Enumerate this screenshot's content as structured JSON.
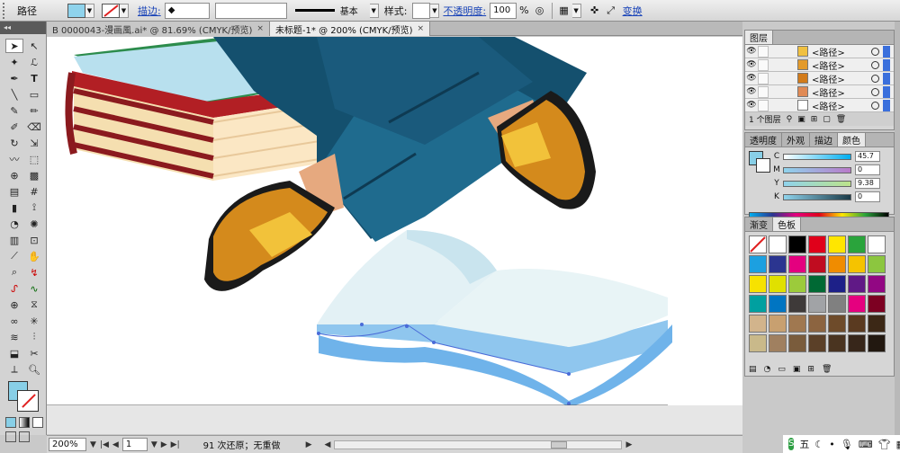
{
  "control_bar": {
    "object_type": "路径",
    "stroke_label": "描边:",
    "stroke_style": "基本",
    "style_label": "样式:",
    "opacity_label": "不透明度:",
    "opacity_value": "100",
    "opacity_unit": "%",
    "transform_link": "变换",
    "fill_color": "#8fd3ec"
  },
  "tabs": [
    {
      "label": "B 0000043-漫画風.ai* @ 81.69% (CMYK/预览)",
      "close": "×"
    },
    {
      "label": "未标题-1* @ 200% (CMYK/预览)",
      "close": "×"
    }
  ],
  "status": {
    "zoom": "200%",
    "page": "1",
    "message": "91 次还原；无重做"
  },
  "layers_panel": {
    "title": "图层",
    "rows": [
      {
        "name": "<路径>",
        "color": "#f0c040"
      },
      {
        "name": "<路径>",
        "color": "#e39a2a"
      },
      {
        "name": "<路径>",
        "color": "#d27b1a"
      },
      {
        "name": "<路径>",
        "color": "#e08a55"
      },
      {
        "name": "<路径>",
        "color": "#ffffff"
      }
    ],
    "footer": "1 个图层"
  },
  "color_panel": {
    "tabs": [
      "透明度",
      "外观",
      "描边",
      "颜色"
    ],
    "channels": [
      {
        "label": "C",
        "value": "45.7"
      },
      {
        "label": "M",
        "value": "0"
      },
      {
        "label": "Y",
        "value": "9.38"
      },
      {
        "label": "K",
        "value": "0"
      }
    ]
  },
  "swatches_panel": {
    "tabs": [
      "渐变",
      "色板"
    ],
    "colors": [
      "#ffffff",
      "#ffffff",
      "#000000",
      "#e0001a",
      "#ffe600",
      "#2aa43c",
      "#ffffff",
      "#1ca0e0",
      "#2b3590",
      "#e4007f",
      "#c00c20",
      "#f08c00",
      "#f5c300",
      "#8cc63f",
      "#f7e200",
      "#e0e000",
      "#9ccb3b",
      "#006934",
      "#1d2088",
      "#601986",
      "#920783",
      "#00a0a0",
      "#0075c2",
      "#3e3a39",
      "#a1a3a6",
      "#808080",
      "#e5007f",
      "#7d0022",
      "#d2b48c",
      "#c8a070",
      "#a07850",
      "#8c6440",
      "#6e4b2a",
      "#5a3a20",
      "#3c2816",
      "#c9b98a",
      "#a08060",
      "#7a5c3c",
      "#5b4028",
      "#4a3420",
      "#37261a",
      "#221810"
    ]
  },
  "taskbar": {
    "ime": "S",
    "ime_text": "五"
  }
}
